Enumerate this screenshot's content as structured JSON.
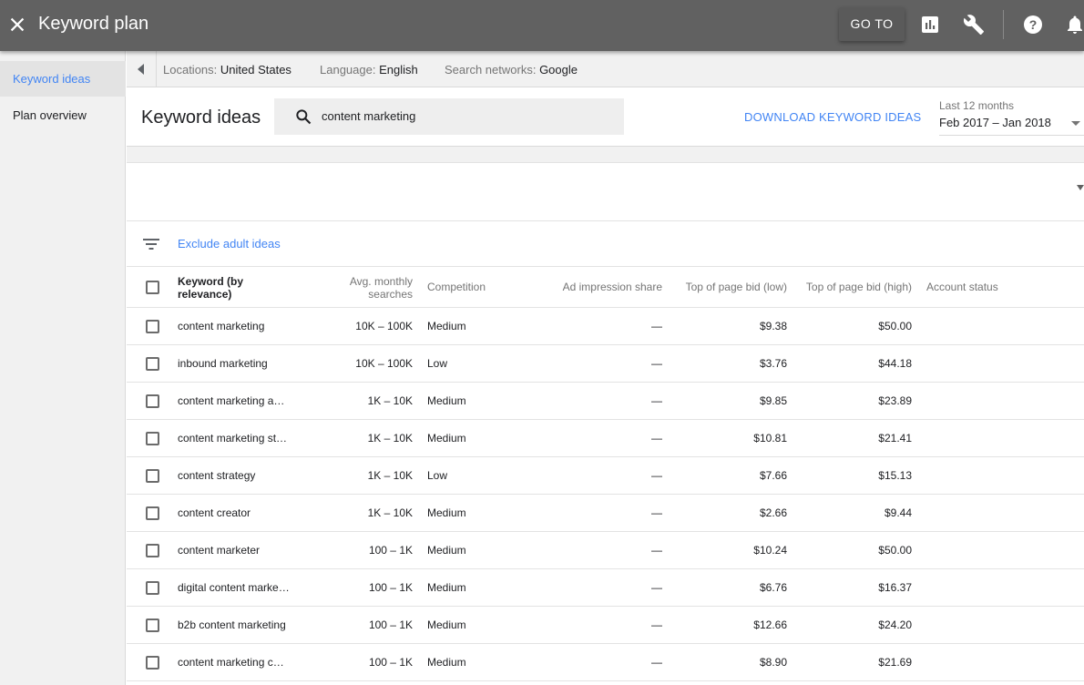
{
  "appbar": {
    "title": "Keyword plan",
    "goto_label": "GO TO",
    "icons": [
      "close-icon",
      "reports-icon",
      "tools-wrench-icon",
      "help-icon",
      "notifications-bell-icon"
    ]
  },
  "sidebar": {
    "items": [
      {
        "label": "Keyword ideas",
        "active": true
      },
      {
        "label": "Plan overview",
        "active": false
      }
    ]
  },
  "filters": {
    "locations_label": "Locations:",
    "locations_value": "United States",
    "language_label": "Language:",
    "language_value": "English",
    "networks_label": "Search networks:",
    "networks_value": "Google"
  },
  "header": {
    "title": "Keyword ideas",
    "search_value": "content marketing",
    "download_label": "DOWNLOAD KEYWORD IDEAS",
    "date_range_label": "Last 12 months",
    "date_range_value": "Feb 2017 – Jan 2018"
  },
  "filter_row": {
    "exclude_label": "Exclude adult ideas"
  },
  "table": {
    "columns": {
      "keyword_line1": "Keyword (by",
      "keyword_line2": "relevance)",
      "searches_line1": "Avg. monthly",
      "searches_line2": "searches",
      "competition": "Competition",
      "impression_share": "Ad impression share",
      "bid_low": "Top of page bid (low)",
      "bid_high": "Top of page bid (high)",
      "account_status": "Account status"
    },
    "rows": [
      {
        "keyword": "content marketing",
        "searches": "10K – 100K",
        "competition": "Medium",
        "impression": "—",
        "bid_low": "$9.38",
        "bid_high": "$50.00",
        "status": ""
      },
      {
        "keyword": "inbound marketing",
        "searches": "10K – 100K",
        "competition": "Low",
        "impression": "—",
        "bid_low": "$3.76",
        "bid_high": "$44.18",
        "status": ""
      },
      {
        "keyword": "content marketing a…",
        "searches": "1K – 10K",
        "competition": "Medium",
        "impression": "—",
        "bid_low": "$9.85",
        "bid_high": "$23.89",
        "status": ""
      },
      {
        "keyword": "content marketing st…",
        "searches": "1K – 10K",
        "competition": "Medium",
        "impression": "—",
        "bid_low": "$10.81",
        "bid_high": "$21.41",
        "status": ""
      },
      {
        "keyword": "content strategy",
        "searches": "1K – 10K",
        "competition": "Low",
        "impression": "—",
        "bid_low": "$7.66",
        "bid_high": "$15.13",
        "status": ""
      },
      {
        "keyword": "content creator",
        "searches": "1K – 10K",
        "competition": "Medium",
        "impression": "—",
        "bid_low": "$2.66",
        "bid_high": "$9.44",
        "status": ""
      },
      {
        "keyword": "content marketer",
        "searches": "100 – 1K",
        "competition": "Medium",
        "impression": "—",
        "bid_low": "$10.24",
        "bid_high": "$50.00",
        "status": ""
      },
      {
        "keyword": "digital content marke…",
        "searches": "100 – 1K",
        "competition": "Medium",
        "impression": "—",
        "bid_low": "$6.76",
        "bid_high": "$16.37",
        "status": ""
      },
      {
        "keyword": "b2b content marketing",
        "searches": "100 – 1K",
        "competition": "Medium",
        "impression": "—",
        "bid_low": "$12.66",
        "bid_high": "$24.20",
        "status": ""
      },
      {
        "keyword": "content marketing c…",
        "searches": "100 – 1K",
        "competition": "Medium",
        "impression": "—",
        "bid_low": "$8.90",
        "bid_high": "$21.69",
        "status": ""
      }
    ]
  }
}
